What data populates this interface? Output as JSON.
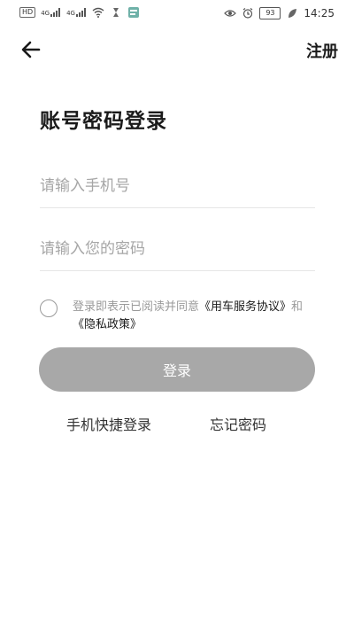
{
  "status_bar": {
    "hd_label": "HD",
    "sim1_label": "4G",
    "sim2_label": "4G",
    "battery_level": "93",
    "time": "14:25"
  },
  "header": {
    "register_label": "注册"
  },
  "title": "账号密码登录",
  "phone_field": {
    "placeholder": "请输入手机号",
    "value": ""
  },
  "password_field": {
    "placeholder": "请输入您的密码",
    "value": ""
  },
  "agreement": {
    "prefix": "登录即表示已阅读并同意",
    "service_link": "《用车服务协议》",
    "conjunction": "和",
    "privacy_link": "《隐私政策》",
    "checked": false
  },
  "login_button_label": "登录",
  "quick_login_label": "手机快捷登录",
  "forgot_password_label": "忘记密码",
  "colors": {
    "button_disabled": "#a8a8a8",
    "text_primary": "#1a1a1a",
    "text_muted": "#9a9a9a"
  }
}
